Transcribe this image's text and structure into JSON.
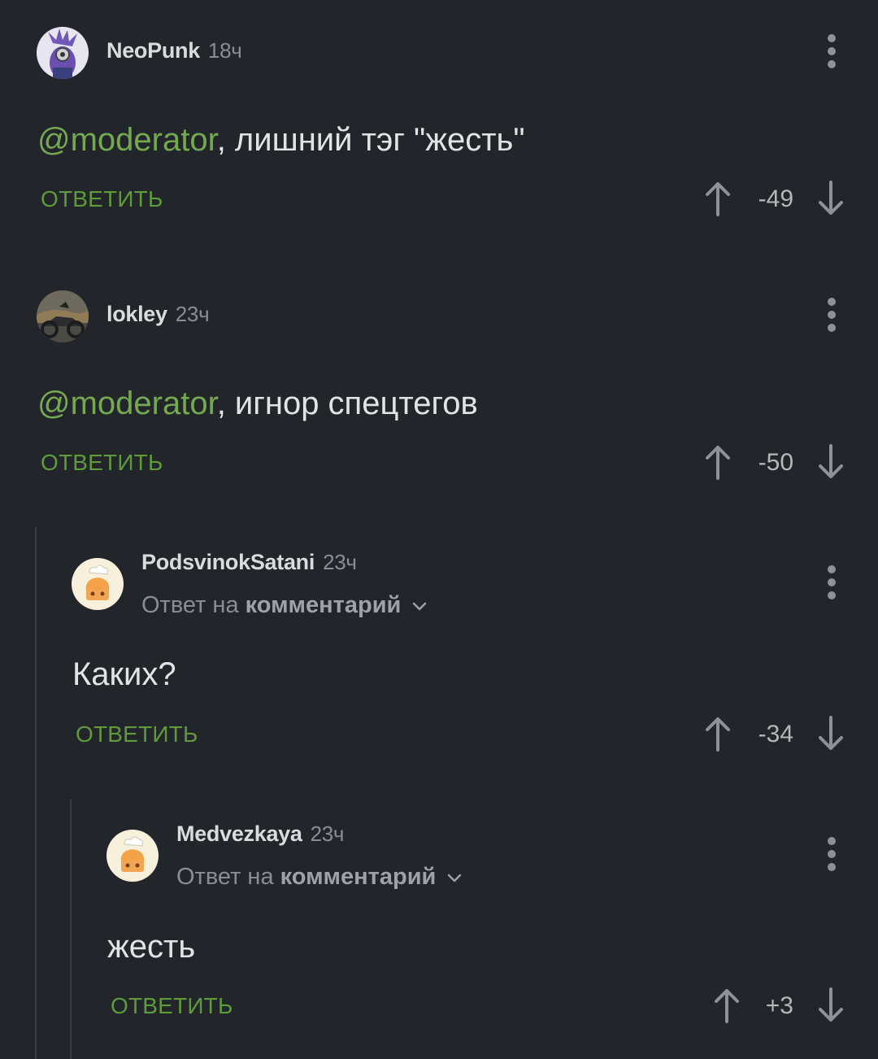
{
  "comments": [
    {
      "author": "NeoPunk",
      "time": "18ч",
      "mention": "@moderator",
      "text": ", лишний тэг \"жесть\"",
      "reply_label": "ОТВЕТИТЬ",
      "score": "-49",
      "avatar_icon": "minion-avatar-icon"
    },
    {
      "author": "lokley",
      "time": "23ч",
      "mention": "@moderator",
      "text": ", игнор спецтегов",
      "reply_label": "ОТВЕТИТЬ",
      "score": "-50",
      "avatar_icon": "motorcycle-avatar-icon"
    },
    {
      "author": "PodsvinokSatani",
      "time": "23ч",
      "reply_prefix": "Ответ на",
      "reply_target": "комментарий",
      "text": "Каких?",
      "reply_label": "ОТВЕТИТЬ",
      "score": "-34",
      "avatar_icon": "chef-avatar-icon"
    },
    {
      "author": "Medvezkaya",
      "time": "23ч",
      "reply_prefix": "Ответ на",
      "reply_target": "комментарий",
      "text": "жесть",
      "reply_label": "ОТВЕТИТЬ",
      "score": "+3",
      "avatar_icon": "chef-avatar-icon"
    }
  ],
  "colors": {
    "background": "#22252a",
    "accent_green": "#5f9a3c",
    "mention_green": "#74a952"
  }
}
